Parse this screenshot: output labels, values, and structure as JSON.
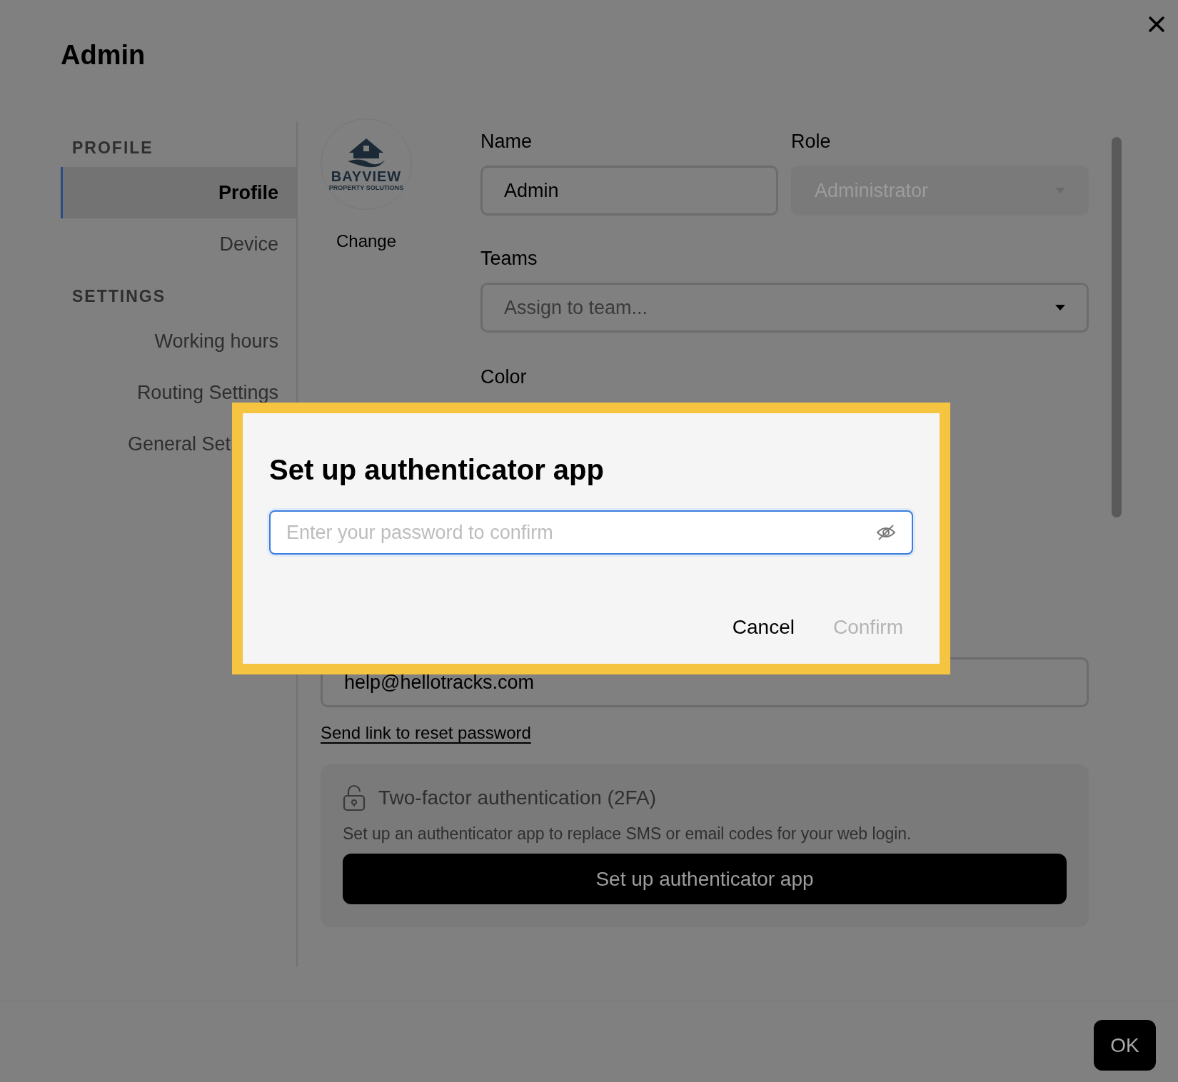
{
  "title": "Admin",
  "sidebar": {
    "sections": [
      {
        "heading": "PROFILE",
        "items": [
          {
            "label": "Profile",
            "selected": true
          },
          {
            "label": "Device",
            "selected": false
          }
        ]
      },
      {
        "heading": "SETTINGS",
        "items": [
          {
            "label": "Working hours",
            "selected": false
          },
          {
            "label": "Routing Settings",
            "selected": false
          },
          {
            "label": "General Set",
            "selected": false
          }
        ]
      }
    ]
  },
  "avatar": {
    "logo_text": "BAYVIEW",
    "logo_subtext": "PROPERTY SOLUTIONS",
    "action": "Change"
  },
  "form": {
    "name": {
      "label": "Name",
      "value": "Admin"
    },
    "role": {
      "label": "Role",
      "value": "Administrator",
      "disabled": true
    },
    "teams": {
      "label": "Teams",
      "placeholder": "Assign to team..."
    },
    "color": {
      "label": "Color"
    },
    "email": {
      "value": "help@hellotracks.com"
    }
  },
  "reset_link": "Send link to reset password",
  "two_factor": {
    "title": "Two-factor authentication (2FA)",
    "description": "Set up an authenticator app to replace SMS or email codes for your web login.",
    "button": "Set up authenticator app"
  },
  "ok_button": "OK",
  "dialog": {
    "title": "Set up authenticator app",
    "password": {
      "placeholder": "Enter your password to confirm"
    },
    "buttons": [
      {
        "label": "Cancel",
        "disabled": false
      },
      {
        "label": "Confirm",
        "disabled": true
      }
    ]
  }
}
